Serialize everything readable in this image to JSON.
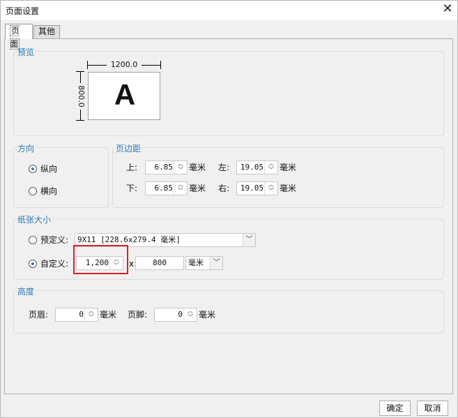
{
  "window": {
    "title": "页面设置"
  },
  "tabs": [
    {
      "label": "页面",
      "active": true
    },
    {
      "label": "其他",
      "active": false
    }
  ],
  "preview": {
    "label": "预览",
    "width_text": "1200.0",
    "height_text": "800.0",
    "letter": "A"
  },
  "orientation": {
    "label": "方向",
    "portrait": "纵向",
    "landscape": "横向",
    "selected": "portrait"
  },
  "margins": {
    "label": "页边距",
    "top_label": "上:",
    "top_value": "6.85",
    "left_label": "左:",
    "left_value": "19.05",
    "bottom_label": "下:",
    "bottom_value": "6.85",
    "right_label": "右:",
    "right_value": "19.05",
    "unit": "毫米"
  },
  "paper": {
    "label": "纸张大小",
    "predefined_label": "预定义:",
    "predefined_value": "9X11 [228.6x279.4 毫米]",
    "custom_label": "自定义:",
    "custom_width": "1,200",
    "separator": "x",
    "custom_height": "800",
    "unit": "毫米",
    "selected": "custom"
  },
  "height_section": {
    "label": "高度",
    "header_label": "页眉:",
    "header_value": "0",
    "footer_label": "页脚:",
    "footer_value": "0",
    "unit": "毫米"
  },
  "buttons": {
    "ok": "确定",
    "cancel": "取消"
  },
  "colors": {
    "group_label": "#2a7bb0",
    "highlight": "#e02020",
    "radio_dot": "#3a6fd8"
  }
}
